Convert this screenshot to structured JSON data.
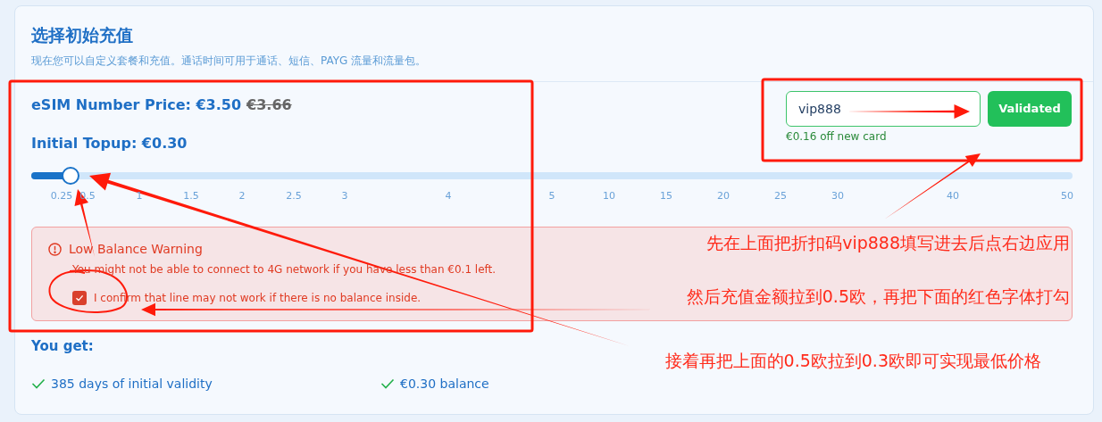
{
  "section": {
    "title": "选择初始充值",
    "subtitle": "现在您可以自定义套餐和充值。通话时间可用于通话、短信、PAYG 流量和流量包。"
  },
  "price": {
    "label": "eSIM Number Price: €3.50",
    "original": "€3.66"
  },
  "topup": {
    "label": "Initial Topup: €0.30",
    "level": 0.038,
    "ticks": [
      "0.25",
      "0.5",
      "1",
      "1.5",
      "2",
      "2.5",
      "3",
      "4",
      "5",
      "10",
      "15",
      "20",
      "25",
      "30",
      "40",
      "50"
    ]
  },
  "promo": {
    "value": "vip888",
    "button": "Validated",
    "note": "€0.16 off new card"
  },
  "warning": {
    "title": "Low Balance Warning",
    "message": "You might not be able to connect to 4G network if you have less than €0.1 left.",
    "confirm": {
      "label": "I confirm that line may not work if there is no balance inside.",
      "checked": true
    }
  },
  "benefits": {
    "title": "You get:",
    "items": [
      "385 days of initial validity",
      "€0.30 balance"
    ]
  },
  "annotations": [
    "先在上面把折扣码vip888填写进去后点右边应用",
    "然后充值金额拉到0.5欧，再把下面的红色字体打勾",
    "接着再把上面的0.5欧拉到0.3欧即可实现最低价格"
  ]
}
